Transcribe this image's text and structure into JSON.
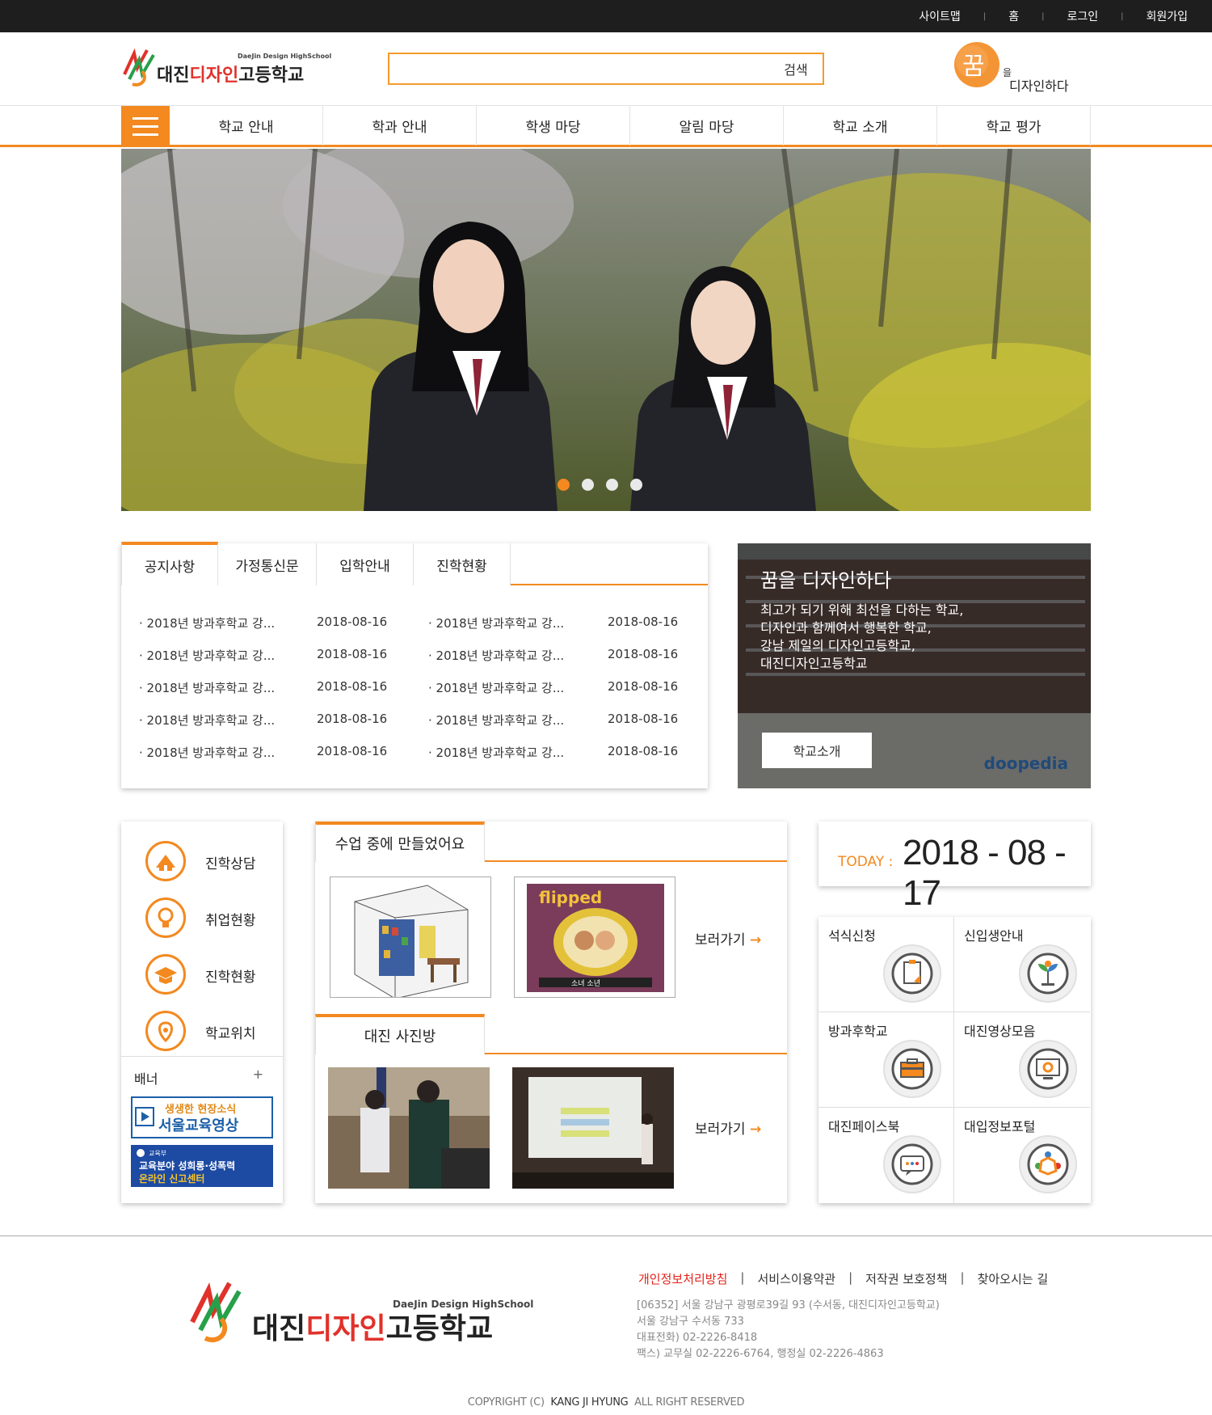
{
  "topbar": {
    "links": [
      "사이트맵",
      "홈",
      "로그인",
      "회원가입"
    ]
  },
  "header": {
    "logo_en": "DaeJin Design HighSchool",
    "logo_ko": [
      "대진",
      "디자인",
      "고등학교"
    ],
    "search_button": "검색",
    "slogan": {
      "big": "꿈",
      "small": "을",
      "rest": "디자인하다"
    }
  },
  "nav": {
    "items": [
      "학교 안내",
      "학과 안내",
      "학생 마당",
      "알림 마당",
      "학교 소개",
      "학교 평가"
    ]
  },
  "notice": {
    "tabs": [
      "공지사항",
      "가정통신문",
      "입학안내",
      "진학현황"
    ],
    "rows": [
      {
        "left_title": "· 2018년 방과후학교 강...",
        "left_date": "2018-08-16",
        "right_title": "· 2018년 방과후학교 강...",
        "right_date": "2018-08-16"
      },
      {
        "left_title": "· 2018년 방과후학교 강...",
        "left_date": "2018-08-16",
        "right_title": "· 2018년 방과후학교 강...",
        "right_date": "2018-08-16"
      },
      {
        "left_title": "· 2018년 방과후학교 강...",
        "left_date": "2018-08-16",
        "right_title": "· 2018년 방과후학교 강...",
        "right_date": "2018-08-16"
      },
      {
        "left_title": "· 2018년 방과후학교 강...",
        "left_date": "2018-08-16",
        "right_title": "· 2018년 방과후학교 강...",
        "right_date": "2018-08-16"
      },
      {
        "left_title": "· 2018년 방과후학교 강...",
        "left_date": "2018-08-16",
        "right_title": "· 2018년 방과후학교 강...",
        "right_date": "2018-08-16"
      }
    ]
  },
  "intro": {
    "title": "꿈을 디자인하다",
    "lines": [
      "최고가 되기 위해 최선을 다하는 학교,",
      "디자인과 함께여서 행복한 학교,",
      "강남 제일의 디자인고등학교,",
      "대진디자인고등학교"
    ],
    "button": "학교소개",
    "watermark": "doopedia"
  },
  "quick": {
    "items": [
      {
        "label": "진학상담",
        "icon": "school-icon"
      },
      {
        "label": "취업현황",
        "icon": "lightbulb-icon"
      },
      {
        "label": "진학현황",
        "icon": "graduation-cap-icon"
      },
      {
        "label": "학교위치",
        "icon": "location-pin-icon"
      }
    ],
    "banner_title": "배너",
    "banner_plus": "+",
    "banner1": [
      "생생한 현장소식",
      "서울교육영상"
    ],
    "banner2": [
      "교육부",
      "교육분야 성희롱·성폭력",
      "온라인 신고센터"
    ]
  },
  "gallery": {
    "class_title": "수업 중에 만들었어요",
    "photo_title": "대진 사진방",
    "more": "보러가기",
    "poster_title": "flipped",
    "poster_text": "소녀 소년"
  },
  "today": {
    "label": "TODAY :",
    "date": "2018 - 08 - 17"
  },
  "services": [
    {
      "label": "석식신청",
      "icon": "document-icon"
    },
    {
      "label": "신입생안내",
      "icon": "sprout-icon"
    },
    {
      "label": "방과후학교",
      "icon": "briefcase-icon"
    },
    {
      "label": "대진영상모음",
      "icon": "monitor-icon"
    },
    {
      "label": "대진페이스북",
      "icon": "chat-icon"
    },
    {
      "label": "대입정보포털",
      "icon": "people-icon"
    }
  ],
  "footer": {
    "links": [
      "개인정보처리방침",
      "서비스이용약관",
      "저작권 보호정책",
      "찾아오시는 길"
    ],
    "address": [
      "[06352] 서울 강남구 광평로39길 93 (수서동, 대진디자인고등학교)",
      "서울 강남구 수서동 733",
      "대표전화) 02-2226-8418",
      "팩스) 교무실 02-2226-6764, 행정실 02-2226-4863"
    ],
    "copyright_pre": "COPYRIGHT (C)",
    "copyright_name": "KANG JI HYUNG",
    "copyright_post": "ALL RIGHT RESERVED"
  },
  "colors": {
    "accent": "#f3891f",
    "topbar": "#1e1e1e",
    "footer_link_active": "#e2231a"
  }
}
